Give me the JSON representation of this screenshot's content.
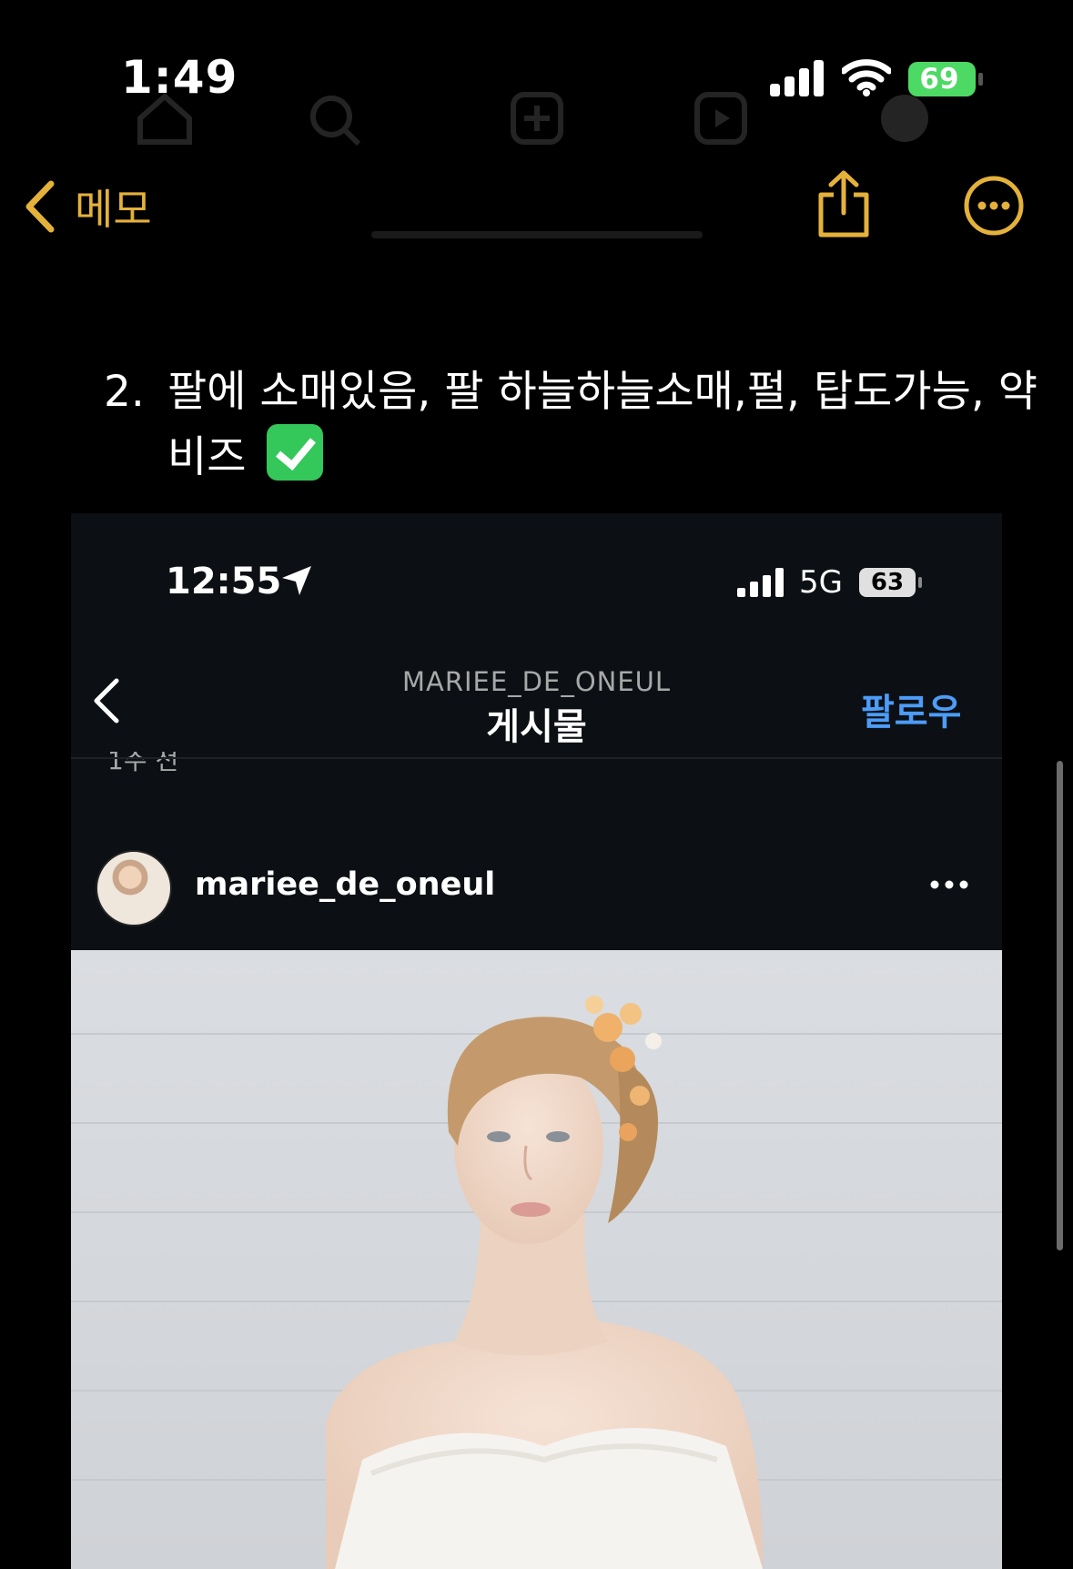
{
  "status_bar": {
    "time": "1:49",
    "battery": "69",
    "battery_color": "#4cd964"
  },
  "nav": {
    "back_label": "메모",
    "accent_color": "#e4b13b",
    "icons": [
      "chevron-left-icon",
      "share-icon",
      "more-circle-icon"
    ]
  },
  "note": {
    "item_number": "2.",
    "item_text": "팔에 소매있음, 팔 하늘하늘소매,펄, 탑도가능, 약비즈",
    "emoji": "check-mark-button-icon"
  },
  "embedded_screenshot": {
    "status_bar": {
      "time": "12:55",
      "network": "5G",
      "battery": "63"
    },
    "header": {
      "account": "MARIEE_DE_ONEUL",
      "title": "게시물",
      "follow_label": "팔로우",
      "follow_color": "#4c9cf8"
    },
    "time_ago": "1주 전",
    "post": {
      "username": "mariee_de_oneul"
    }
  }
}
